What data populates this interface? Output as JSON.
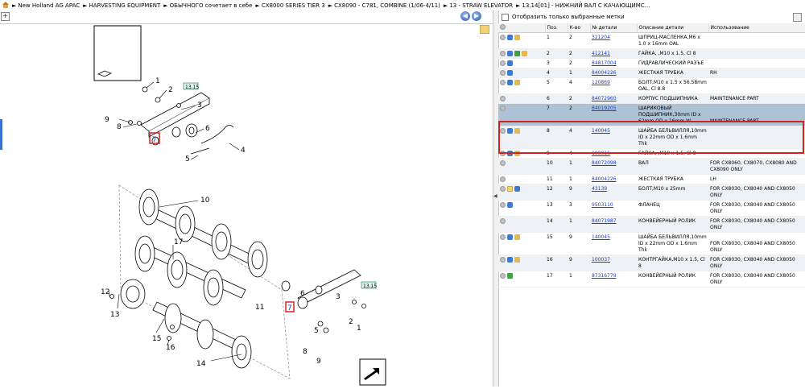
{
  "breadcrumb": [
    "New Holland AG APAC",
    "HARVESTING EQUIPMENT",
    "ОБЫЧНОГО сочетает в себе",
    "CX8000 SERIES TIER 3",
    "CX8090 - C781, COMBINE (1/06-4/11)",
    "13 - STRAW ELEVATOR",
    "13.14[01] - НИЖНИЙ ВАЛ С КАЧАЮЩИМС..."
  ],
  "filter": {
    "label": "Отобразить только выбранные метки"
  },
  "table": {
    "headers": [
      "Поз.",
      "К-во",
      "№ детали",
      "Описание детали",
      "Использование"
    ],
    "rows": [
      {
        "pos": "1",
        "qty": "2",
        "part": "321204",
        "desc": "ШПРИЦ-МАСЛЕНКА,M6 x 1.0 x 16mm OAL",
        "usage": "",
        "icons": [
          "grey",
          "blue",
          "box"
        ]
      },
      {
        "pos": "2",
        "qty": "2",
        "part": "412141",
        "desc": "ГАЙКА, ,M10 x 1.5, Cl 8",
        "usage": "",
        "icons": [
          "grey",
          "blue",
          "green",
          "box"
        ]
      },
      {
        "pos": "3",
        "qty": "2",
        "part": "84817004",
        "desc": "ГИДРАВЛИЧЕСКИЙ РАЗЪЕ",
        "usage": "",
        "icons": [
          "grey",
          "blue"
        ]
      },
      {
        "pos": "4",
        "qty": "1",
        "part": "84004226",
        "desc": "ЖЕСТКАЯ ТРУБКА",
        "usage": "RH",
        "icons": [
          "grey",
          "blue"
        ]
      },
      {
        "pos": "5",
        "qty": "4",
        "part": "120869",
        "desc": "БОЛТ,M10 x 1.5 x 56.58mm OAL, Cl 8.8",
        "usage": "",
        "icons": [
          "grey",
          "blue",
          "box"
        ]
      },
      {
        "pos": "6",
        "qty": "2",
        "part": "84072960",
        "desc": "КОРПУС ПОДШИПНИКА",
        "usage": "MAINTENANCE PART",
        "icons": [
          "grey"
        ]
      },
      {
        "pos": "7",
        "qty": "2",
        "part": "84019205",
        "desc": "ШАРИКОВЫЙ ПОДШИПНИК,30mm ID x 62mm OD x 16mm W",
        "usage": "MAINTENANCE PART",
        "icons": [
          "grey"
        ]
      },
      {
        "pos": "8",
        "qty": "4",
        "part": "140045",
        "desc": "ШАЙБА БЕЛЬВИЛЛЯ,10mm ID x 22mm OD x 1.6mm Thk",
        "usage": "",
        "icons": [
          "grey",
          "blue",
          "box"
        ]
      },
      {
        "pos": "9",
        "qty": "4",
        "part": "100016",
        "desc": "ГАЙКА, ,M10 x 1.5, Cl 8",
        "usage": "",
        "icons": [
          "grey",
          "blue",
          "box"
        ]
      },
      {
        "pos": "10",
        "qty": "1",
        "part": "84072098",
        "desc": "ВАЛ",
        "usage": "FOR CX8060, CX8070, CX8080 AND CX8090 ONLY",
        "icons": [
          "grey"
        ]
      },
      {
        "pos": "11",
        "qty": "1",
        "part": "84004226",
        "desc": "ЖЕСТКАЯ ТРУБКА",
        "usage": "LH",
        "icons": [
          "grey"
        ]
      },
      {
        "pos": "12",
        "qty": "9",
        "part": "43139",
        "desc": "БОЛТ,M10 x 25mm",
        "usage": "FOR CX8030, CX8040 AND CX8050 ONLY",
        "icons": [
          "grey",
          "doc",
          "blue"
        ]
      },
      {
        "pos": "13",
        "qty": "3",
        "part": "9503110",
        "desc": "ФЛАНЕЦ",
        "usage": "FOR CX8030, CX8040 AND CX8050 ONLY",
        "icons": [
          "grey",
          "blue"
        ]
      },
      {
        "pos": "14",
        "qty": "1",
        "part": "84071987",
        "desc": "КОНВЕЙЕРНЫЙ РОЛИК",
        "usage": "FOR CX8030, CX8040 AND CX8050 ONLY",
        "icons": [
          "grey"
        ]
      },
      {
        "pos": "15",
        "qty": "9",
        "part": "140045",
        "desc": "ШАЙБА БЕЛЬВИЛЛЯ,10mm ID x 22mm OD x 1.6mm Thk",
        "usage": "FOR CX8030, CX8040 AND CX8050 ONLY",
        "icons": [
          "grey",
          "blue",
          "box"
        ]
      },
      {
        "pos": "16",
        "qty": "9",
        "part": "100037",
        "desc": "КОНТРГАЙКА,M10 x 1.5, Cl 8",
        "usage": "FOR CX8030, CX8040 AND CX8050 ONLY",
        "icons": [
          "grey",
          "blue",
          "box"
        ]
      },
      {
        "pos": "17",
        "qty": "1",
        "part": "87316779",
        "desc": "КОНВЕЙЕРНЫЙ РОЛИК",
        "usage": "FOR CX8030, CX8040 AND CX8050 ONLY",
        "icons": [
          "grey",
          "green"
        ]
      }
    ]
  },
  "diagram": {
    "callouts": [
      "1",
      "2",
      "3",
      "4",
      "5",
      "6",
      "7",
      "8",
      "9",
      "10",
      "11",
      "12",
      "13",
      "14",
      "15",
      "16",
      "17"
    ],
    "ref_tag": "13.15",
    "highlight": "7"
  },
  "colors": {
    "selection": "#aec2d6",
    "selection_border": "#d32222",
    "link": "#1a3ecf"
  }
}
